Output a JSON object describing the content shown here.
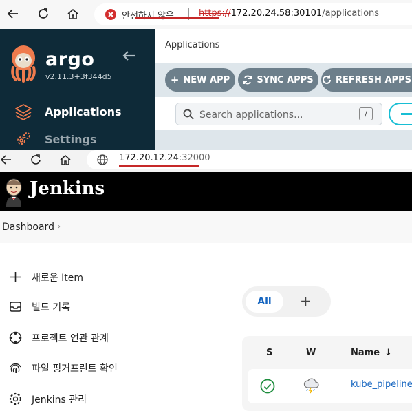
{
  "browser_top": {
    "security_text": "안전하지 않음",
    "url_scheme": "https://",
    "url_host": "172.20.24.58:30101",
    "url_path": "/applications"
  },
  "argo": {
    "brand": "argo",
    "version": "v2.11.3+3f344d5",
    "nav": [
      {
        "label": "Applications"
      },
      {
        "label": "Settings"
      }
    ],
    "page_title": "Applications",
    "toolbar": {
      "new_app": "NEW APP",
      "sync_apps": "SYNC APPS",
      "refresh_apps": "REFRESH APPS"
    },
    "search": {
      "placeholder": "Search applications...",
      "shortcut": "/"
    },
    "colors": {
      "sidebar": "#0e2a38",
      "button": "#6d7f8b",
      "accent": "#18bed4"
    }
  },
  "browser_bottom": {
    "url_host": "172.20.12.24",
    "url_port": ":32000"
  },
  "jenkins": {
    "brand": "Jenkins",
    "breadcrumb": "Dashboard",
    "sidebar": [
      {
        "label": "새로운 Item",
        "icon": "plus-icon"
      },
      {
        "label": "빌드 기록",
        "icon": "inbox-icon"
      },
      {
        "label": "프로젝트 연관 관계",
        "icon": "relationship-icon"
      },
      {
        "label": "파일 핑거프린트 확인",
        "icon": "fingerprint-icon"
      },
      {
        "label": "Jenkins 관리",
        "icon": "gear-icon"
      }
    ],
    "tabs": {
      "all": "All",
      "add": "+"
    },
    "table": {
      "headers": {
        "s": "S",
        "w": "W",
        "name": "Name",
        "sort": "↓"
      },
      "rows": [
        {
          "status": "success",
          "weather": "thunderstorm",
          "name": "kube_pipeline"
        }
      ]
    }
  }
}
